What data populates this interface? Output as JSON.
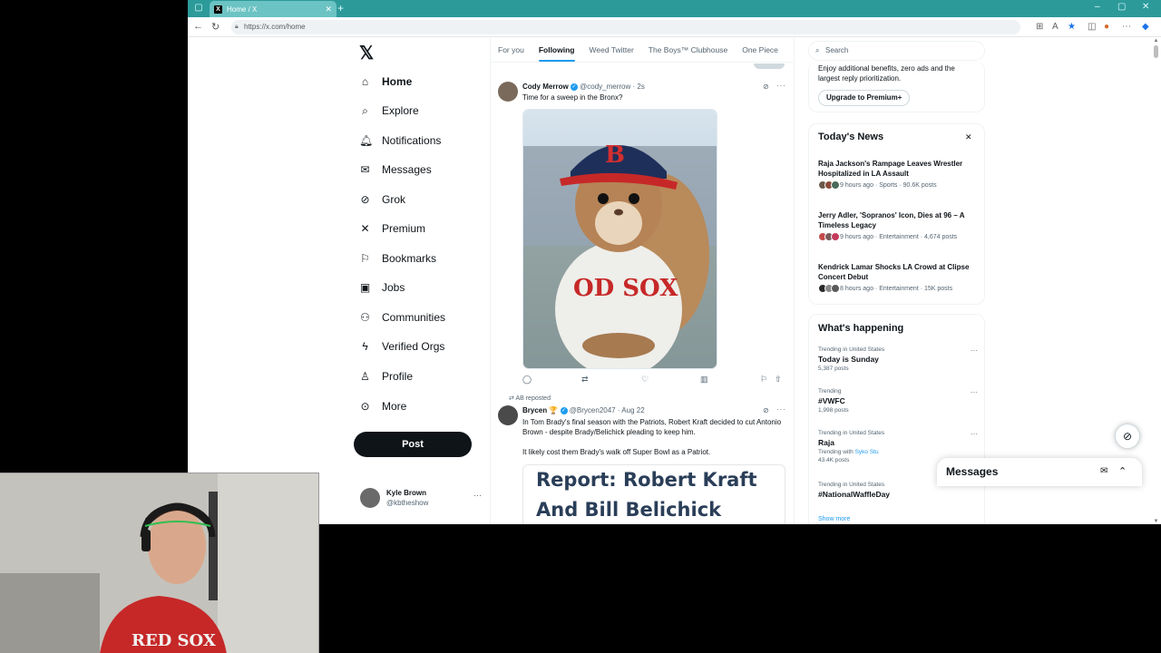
{
  "browser": {
    "tab_title": "Home / X",
    "url": "https://x.com/home"
  },
  "nav": {
    "items": [
      {
        "label": "Home",
        "icon": "home-icon"
      },
      {
        "label": "Explore",
        "icon": "search-icon"
      },
      {
        "label": "Notifications",
        "icon": "bell-icon"
      },
      {
        "label": "Messages",
        "icon": "mail-icon"
      },
      {
        "label": "Grok",
        "icon": "grok-icon"
      },
      {
        "label": "Premium",
        "icon": "x-icon"
      },
      {
        "label": "Bookmarks",
        "icon": "bookmark-icon"
      },
      {
        "label": "Jobs",
        "icon": "briefcase-icon"
      },
      {
        "label": "Communities",
        "icon": "people-icon"
      },
      {
        "label": "Verified Orgs",
        "icon": "lightning-icon"
      },
      {
        "label": "Profile",
        "icon": "person-icon"
      },
      {
        "label": "More",
        "icon": "more-circle-icon"
      }
    ],
    "post_label": "Post",
    "profile": {
      "name": "Kyle Brown",
      "handle": "@kbtheshow"
    }
  },
  "feed": {
    "tabs": [
      "For you",
      "Following",
      "Weed Twitter",
      "The Boys™ Clubhouse",
      "One Piece"
    ],
    "active_tab": "Following",
    "tweet1": {
      "name": "Cody Merrow",
      "handle": "@cody_merrow",
      "time": "· 2s",
      "text": "Time for a sweep in the Bronx?",
      "image_desc_icon": "squirrel-red-sox-image"
    },
    "tweet2": {
      "repost_label": "AB reposted",
      "name": "Brycen",
      "badge": "🏆",
      "handle": "@Brycen2047",
      "time": "· Aug 22",
      "text1": "In Tom Brady's final season with the Patriots, Robert Kraft decided to cut Antonio Brown - despite Brady/Belichick pleading to keep him.",
      "text2": "It likely cost them Brady's walk off Super Bowl as a Patriot.",
      "card_title": "Report: Robert Kraft And Bill Belichick Disagreed"
    }
  },
  "right": {
    "search_placeholder": "Search",
    "premium": {
      "desc": "Enjoy additional benefits, zero ads and the largest reply prioritization.",
      "button": "Upgrade to Premium+"
    },
    "news": {
      "title": "Today's News",
      "items": [
        {
          "headline": "Raja Jackson's Rampage Leaves Wrestler Hospitalized in LA Assault",
          "meta": "9 hours ago · Sports · 90.6K posts"
        },
        {
          "headline": "Jerry Adler, 'Sopranos' Icon, Dies at 96 – A Timeless Legacy",
          "meta": "9 hours ago · Entertainment · 4,674 posts"
        },
        {
          "headline": "Kendrick Lamar Shocks LA Crowd at Clipse Concert Debut",
          "meta": "8 hours ago · Entertainment · 15K posts"
        }
      ]
    },
    "happening": {
      "title": "What's happening",
      "trends": [
        {
          "context": "Trending in United States",
          "title": "Today is Sunday",
          "count": "5,387 posts"
        },
        {
          "context": "Trending",
          "title": "#VWFC",
          "count": "1,998 posts"
        },
        {
          "context": "Trending in United States",
          "title": "Raja",
          "extra": "Trending with",
          "extra_link": "Syko Stu",
          "count": "43.4K posts"
        },
        {
          "context": "Trending in United States",
          "title": "#NationalWaffleDay",
          "count": ""
        }
      ],
      "show_more": "Show more"
    }
  },
  "messages_drawer": {
    "title": "Messages"
  },
  "colors": {
    "accent": "#1d9bf0",
    "tabstrip": "#2d9a9a"
  }
}
